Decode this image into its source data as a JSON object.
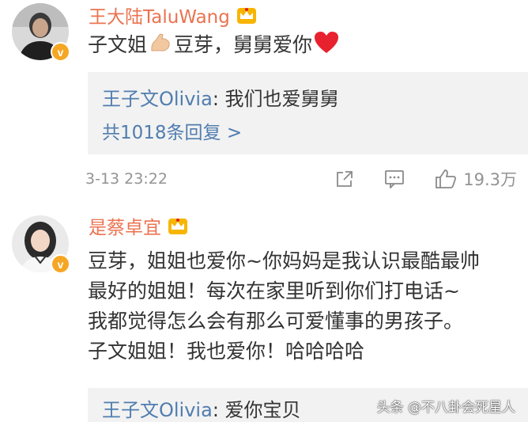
{
  "comments": [
    {
      "username": "王大陆TaluWang",
      "text_part1": "子文姐",
      "text_part2": "豆芽，舅舅爱你",
      "reply": {
        "user": "王子文Olivia",
        "separator": ": ",
        "text": "我们也爱舅舅",
        "more": "共1018条回复 >"
      },
      "time": "3-13 23:22",
      "likes": "19.3万"
    },
    {
      "username": "是蔡卓宜",
      "text_lines": [
        "豆芽，姐姐也爱你~你妈妈是我认识最酷最帅",
        "最好的姐姐！每次在家里听到你们打电话~",
        "我都觉得怎么会有那么可爱懂事的男孩子。",
        "子文姐姐！我也爱你！哈哈哈哈"
      ],
      "reply": {
        "user": "王子文Olivia",
        "separator": ": ",
        "text": "爱你宝贝"
      }
    }
  ],
  "watermark": "头条 @不八卦会死星人",
  "colors": {
    "username": "#eb7350",
    "link": "#507daf",
    "reply_bg": "#f2f2f2",
    "meta": "#939393",
    "verified_badge": "#f5a623"
  },
  "icons": [
    "crown-badge-icon",
    "verified-badge-icon",
    "muscle-emoji-icon",
    "heart-emoji-icon",
    "share-icon",
    "comment-icon",
    "like-icon"
  ]
}
